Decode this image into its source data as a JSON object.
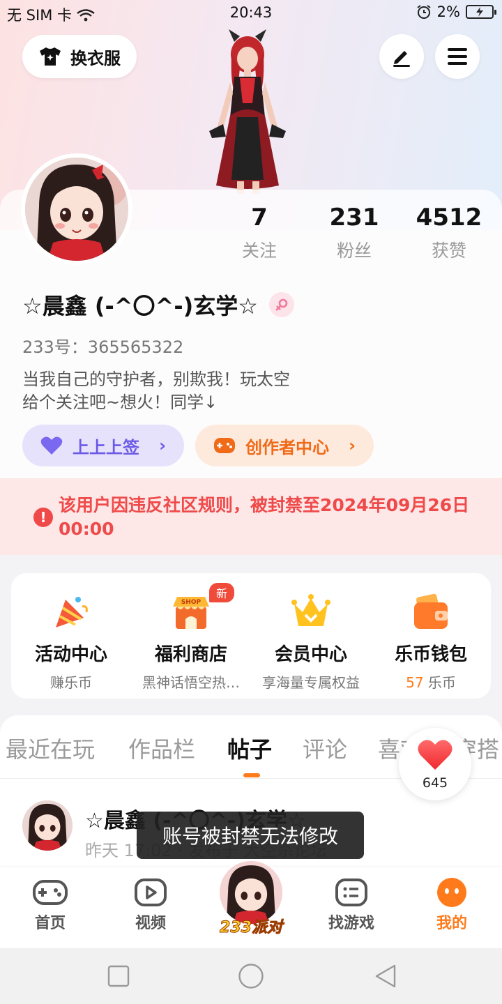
{
  "status": {
    "carrier": "无 SIM 卡",
    "time": "20:43",
    "battery": "2%"
  },
  "header": {
    "wardrobe_label": "换衣服"
  },
  "profile": {
    "name": "☆晨鑫 (-^〇^-)玄学☆",
    "uid": "233号：365565322",
    "bio_line1": "当我自己的守护者，别欺我！玩太空",
    "bio_line2": "给个关注吧~想火！同学↓",
    "stats": [
      {
        "num": "7",
        "label": "关注"
      },
      {
        "num": "231",
        "label": "粉丝"
      },
      {
        "num": "4512",
        "label": "获赞"
      }
    ],
    "chip_sign": "上上上签",
    "chip_creator": "创作者中心"
  },
  "ban": {
    "text": "该用户因违反社区规则，被封禁至2024年09月26日 00:00"
  },
  "services": [
    {
      "title": "活动中心",
      "sub": "赚乐币",
      "icon": "party-horn-icon"
    },
    {
      "title": "福利商店",
      "sub": "黑神话悟空热…",
      "icon": "shop-icon",
      "badge": "新"
    },
    {
      "title": "会员中心",
      "sub": "享海量专属权益",
      "icon": "crown-icon"
    },
    {
      "title": "乐币钱包",
      "sub_num": "57",
      "sub_unit": " 乐币",
      "icon": "wallet-icon"
    }
  ],
  "tabs": [
    "最近在玩",
    "作品栏",
    "帖子",
    "评论",
    "喜欢",
    "穿搭"
  ],
  "active_tab": "帖子",
  "likes": {
    "count": "645"
  },
  "post": {
    "author": "☆晨鑫 (-^〇^-)玄学☆",
    "meta": "昨天 17:02 · 发布于 大空杀论坛"
  },
  "toast": "账号被封禁无法修改",
  "nav": [
    {
      "label": "首页",
      "icon": "gamepad-icon"
    },
    {
      "label": "视频",
      "icon": "video-play-icon"
    },
    {
      "label": "233派对",
      "icon": "party-avatar"
    },
    {
      "label": "找游戏",
      "icon": "game-list-icon"
    },
    {
      "label": "我的",
      "icon": "profile-face-icon"
    }
  ],
  "colors": {
    "accent": "#ff7a1a",
    "ban_red": "#ef4a4a",
    "sign_purple": "#6a5ae6"
  }
}
